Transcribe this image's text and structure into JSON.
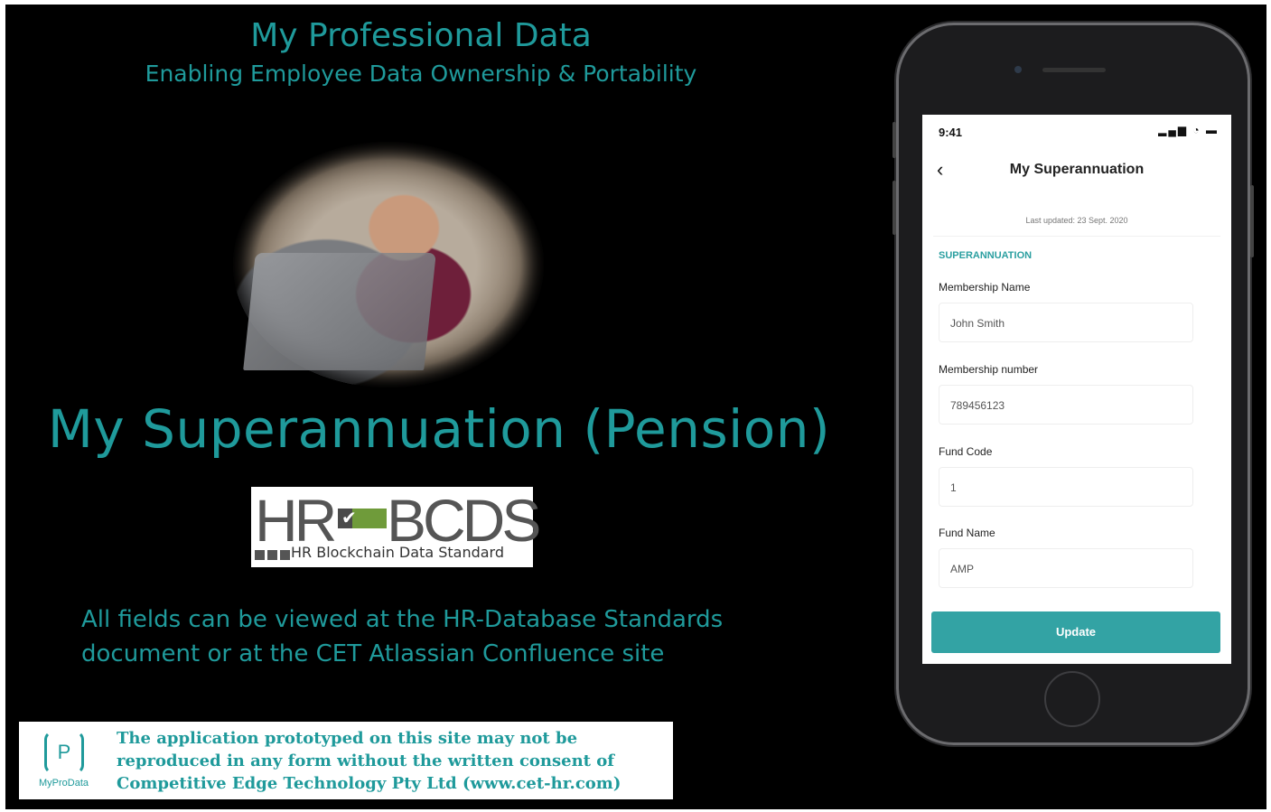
{
  "header": {
    "title": "My Professional Data",
    "subtitle": "Enabling Employee Data Ownership & Portability"
  },
  "main": {
    "heading": "My Superannuation (Pension)",
    "note_line1": "All fields can be viewed at the HR-Database Standards",
    "note_line2": "document or at the CET Atlassian Confluence site"
  },
  "logo": {
    "hr": "HR",
    "bcds": "BCDS",
    "tagline": "HR Blockchain Data Standard"
  },
  "footer": {
    "logo_letter": "P",
    "logo_name": "MyProData",
    "text": "The application prototyped on this site may not be reproduced in any form without the written consent of Competitive Edge Technology Pty Ltd (www.cet-hr.com)"
  },
  "phone": {
    "status_time": "9:41",
    "status_icons": "signal wifi battery",
    "back_icon": "chevron-left-icon",
    "title": "My Superannuation",
    "last_updated": "Last updated: 23 Sept. 2020",
    "section": "SUPERANNUATION",
    "fields": [
      {
        "label": "Membership Name",
        "value": "John Smith"
      },
      {
        "label": "Membership number",
        "value": "789456123"
      },
      {
        "label": "Fund Code",
        "value": "1"
      },
      {
        "label": "Fund Name",
        "value": "AMP"
      }
    ],
    "update_label": "Update"
  },
  "colors": {
    "accent": "#1f9a9b",
    "button": "#33a3a4",
    "background": "#000000"
  }
}
